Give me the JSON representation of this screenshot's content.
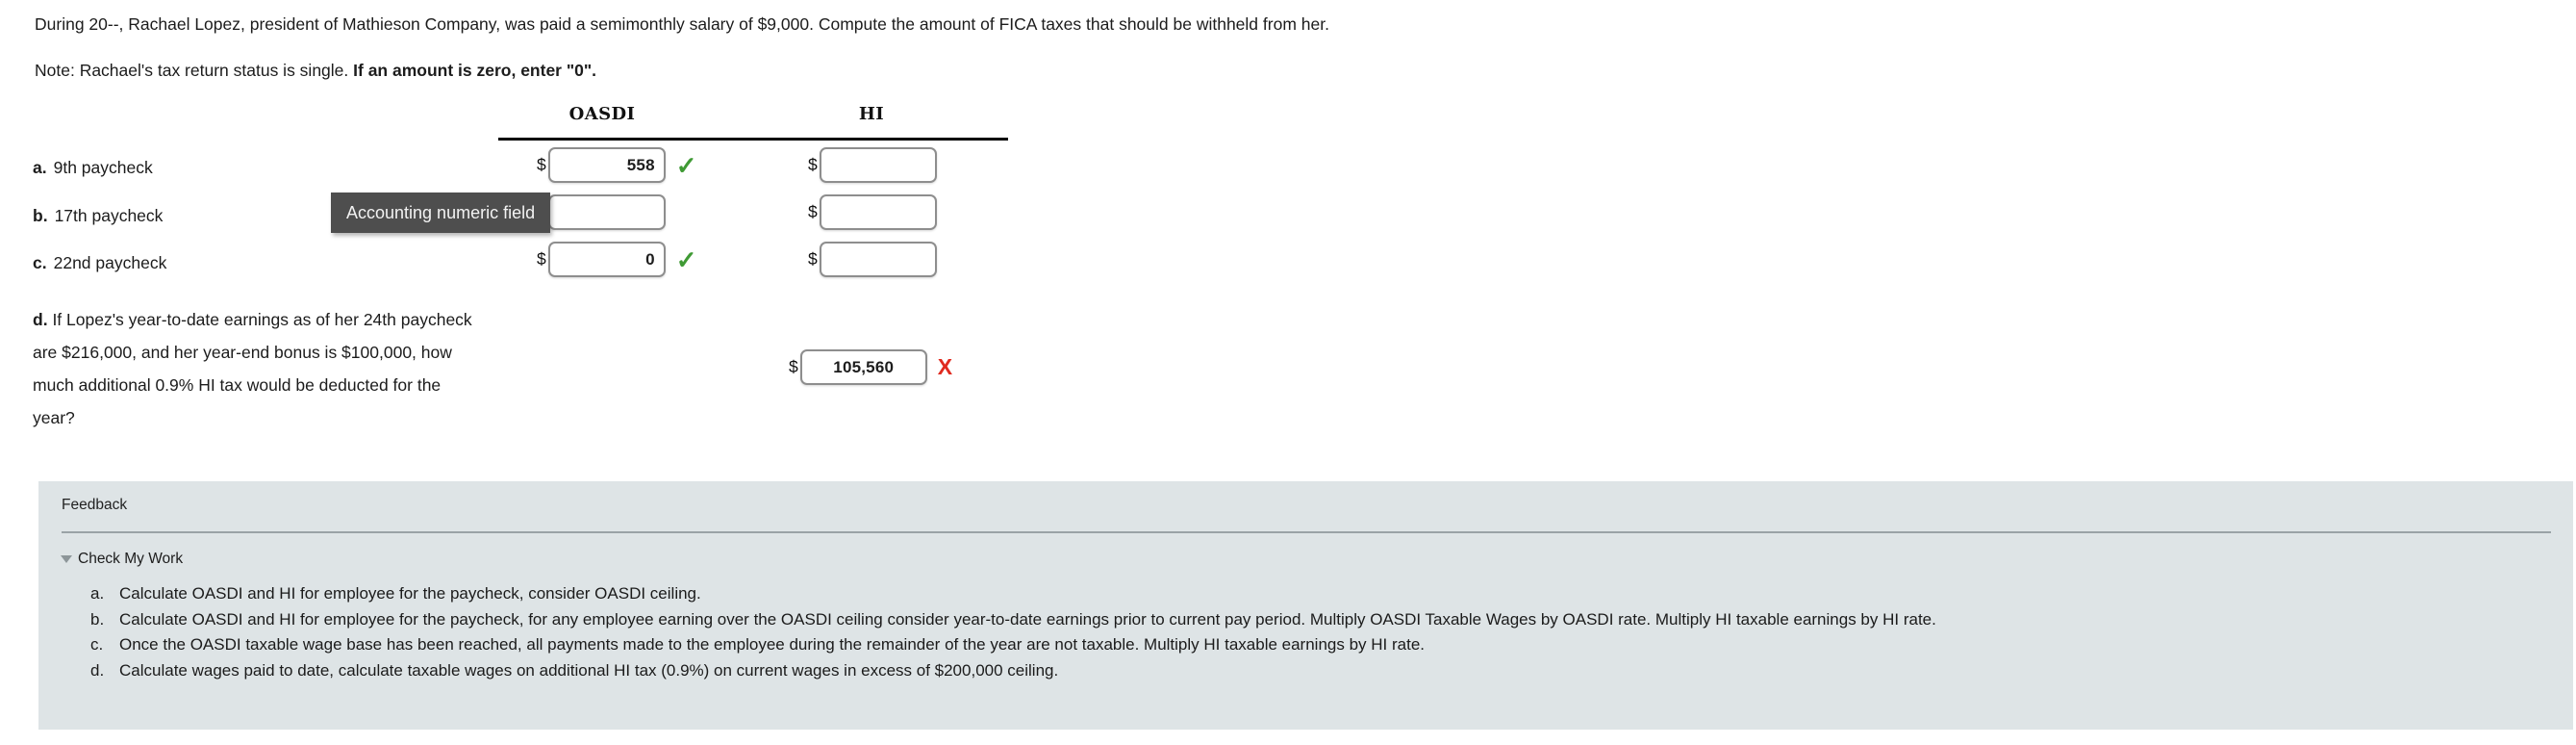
{
  "problem": {
    "statement": "During 20--, Rachael Lopez, president of Mathieson Company, was paid a semimonthly salary of $9,000. Compute the amount of FICA taxes that should be withheld from her.",
    "note_plain": "Note: Rachael's tax return status is single. ",
    "note_bold": "If an amount is zero, enter \"0\"."
  },
  "table": {
    "headers": {
      "oasdi": "OASDI",
      "hi": "HI"
    },
    "currency_symbol": "$",
    "rows": [
      {
        "mark": "a.",
        "label": "9th paycheck",
        "oasdi_value": "558",
        "oasdi_status": "correct",
        "oasdi_status_glyph": "✓",
        "hi_value": "",
        "hi_status": "empty"
      },
      {
        "mark": "b.",
        "label": "17th paycheck",
        "oasdi_value": "",
        "oasdi_status": "empty",
        "hi_value": "",
        "hi_status": "empty"
      },
      {
        "mark": "c.",
        "label": "22nd paycheck",
        "oasdi_value": "0",
        "oasdi_status": "correct",
        "oasdi_status_glyph": "✓",
        "hi_value": "",
        "hi_status": "empty"
      }
    ],
    "row_d": {
      "mark": "d.",
      "label": "If Lopez's year-to-date earnings as of her 24th paycheck are $216,000, and her year-end bonus is $100,000, how much additional 0.9% HI tax would be deducted for the year?",
      "value": "105,560",
      "status": "incorrect",
      "status_glyph": "X"
    }
  },
  "tooltip": {
    "text": "Accounting numeric field"
  },
  "feedback": {
    "title": "Feedback",
    "check_my_work_label": "Check My Work",
    "items": [
      {
        "letter": "a.",
        "text": "Calculate OASDI and HI for employee for the paycheck, consider OASDI ceiling."
      },
      {
        "letter": "b.",
        "text": "Calculate OASDI and HI for employee for the paycheck, for any employee earning over the OASDI ceiling consider year-to-date earnings prior to current pay period. Multiply OASDI Taxable Wages by OASDI rate. Multiply HI taxable earnings by HI rate."
      },
      {
        "letter": "c.",
        "text": "Once the OASDI taxable wage base has been reached, all payments made to the employee during the remainder of the year are not taxable. Multiply HI taxable earnings by HI rate."
      },
      {
        "letter": "d.",
        "text": "Calculate wages paid to date, calculate taxable wages on additional HI tax (0.9%) on current wages in excess of $200,000 ceiling."
      }
    ]
  },
  "colors": {
    "correct_green": "#3f9a34",
    "incorrect_red": "#e02b20",
    "feedback_bg": "#dee4e6",
    "tooltip_bg": "#4e4e4e",
    "field_border": "#8e8e8e"
  }
}
